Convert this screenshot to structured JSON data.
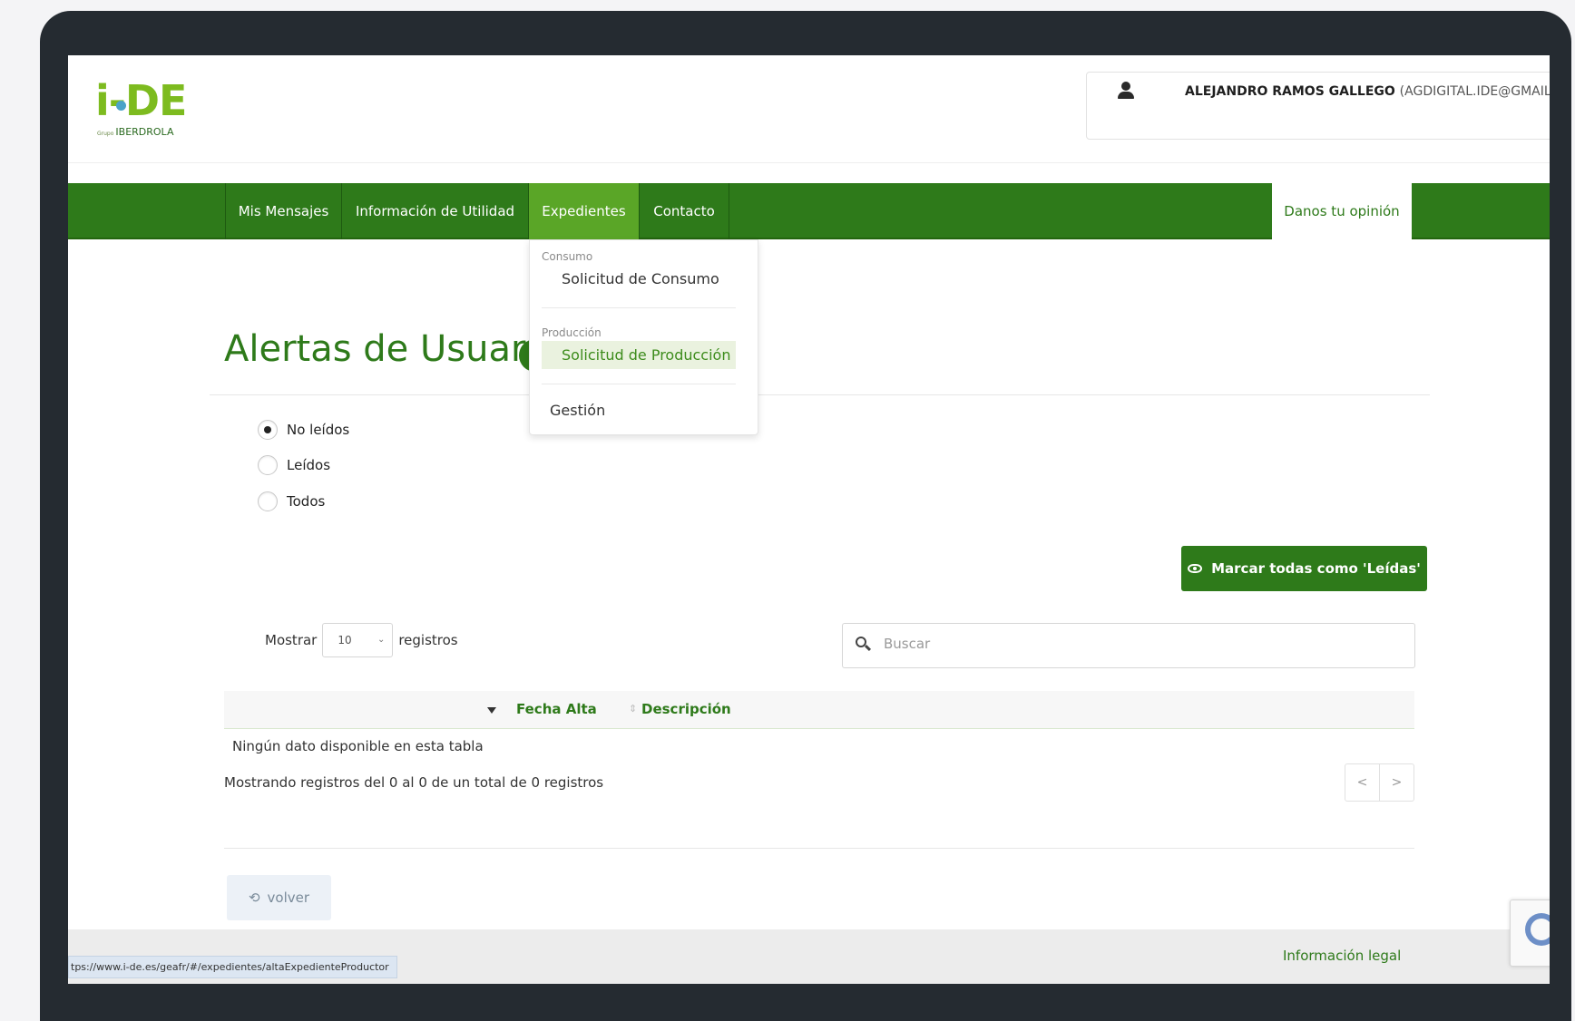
{
  "header": {
    "logo_text": "i-DE",
    "logo_subtitle_small": "Grupo",
    "logo_subtitle": "IBERDROLA",
    "user_name": "ALEJANDRO RAMOS GALLEGO",
    "user_email": "(AGDIGITAL.IDE@GMAIL.C"
  },
  "nav": {
    "items": [
      {
        "label": "Mis Mensajes"
      },
      {
        "label": "Información de Utilidad"
      },
      {
        "label": "Expedientes"
      },
      {
        "label": "Contacto"
      }
    ],
    "feedback": "Danos tu opinión"
  },
  "dropdown": {
    "sections": [
      {
        "header": "Consumo",
        "item": "Solicitud de Consumo"
      },
      {
        "header": "Producción",
        "item": "Solicitud de Producción"
      }
    ],
    "gestion": "Gestión"
  },
  "main": {
    "title": "Alertas de Usuario",
    "filters": [
      {
        "label": "No leídos",
        "checked": true
      },
      {
        "label": "Leídos",
        "checked": false
      },
      {
        "label": "Todos",
        "checked": false
      }
    ],
    "mark_all_button": "Marcar todas como 'Leídas'",
    "show_label": "Mostrar",
    "page_size": "10",
    "records_label": "registros",
    "search_placeholder": "Buscar",
    "columns": [
      "Fecha Alta",
      "Descripción"
    ],
    "empty_message": "Ningún dato disponible en esta tabla",
    "info": "Mostrando registros del 0 al 0 de un total de 0 registros",
    "prev": "<",
    "next": ">",
    "back_button": "volver"
  },
  "footer": {
    "legal_link": "Información legal",
    "status_url": "tps://www.i-de.es/geafr/#/expedientes/altaExpedienteProductor"
  },
  "colors": {
    "brand_green": "#2e7a1a",
    "active_green": "#5aa627",
    "logo_green": "#7dbb1f"
  }
}
